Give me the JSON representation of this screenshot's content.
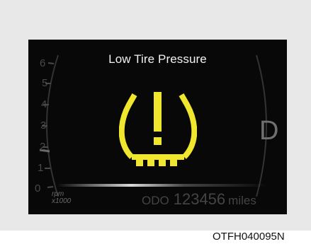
{
  "warning": {
    "title": "Low Tire Pressure",
    "icon": "tire-pressure-warning-icon",
    "icon_color": "#f0e62e"
  },
  "tachometer": {
    "ticks": [
      "0",
      "1",
      "2",
      "3",
      "4",
      "5",
      "6"
    ],
    "unit_line1": "rpm",
    "unit_line2": "x1000"
  },
  "gear": {
    "indicator": "D"
  },
  "odometer": {
    "label": "ODO",
    "value": "123456",
    "unit": "miles"
  },
  "caption": "OTFH040095N",
  "colors": {
    "display_background": "#080808",
    "frame_background": "#e8e8e8",
    "warning_yellow": "#f0e62e",
    "dim_gauge": "#4a4a4a"
  }
}
